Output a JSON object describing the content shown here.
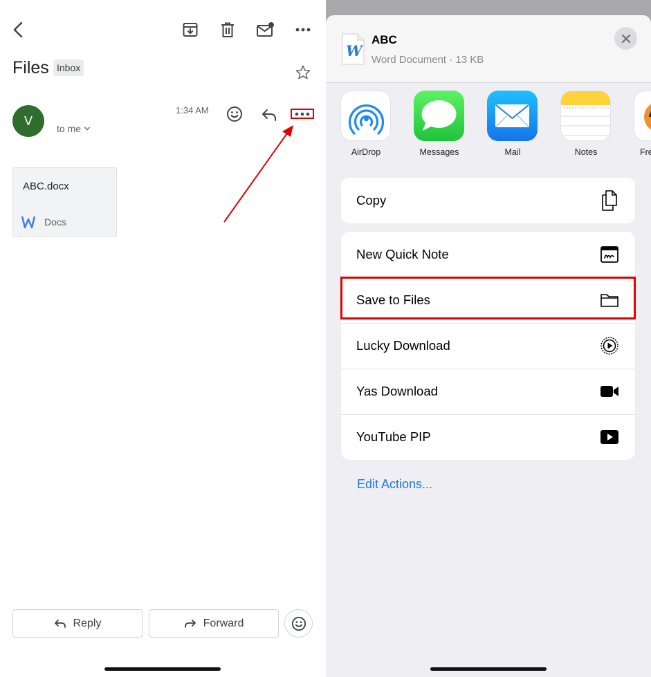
{
  "gmail": {
    "subject": "Files",
    "label_badge": "Inbox",
    "sender_initial": "V",
    "to_me": "to me",
    "time": "1:34 AM",
    "attachment": {
      "name": "ABC.docx",
      "type": "Docs"
    },
    "buttons": {
      "reply": "Reply",
      "forward": "Forward"
    },
    "icons": [
      "back-icon",
      "archive-icon",
      "trash-icon",
      "mark-unread-icon",
      "more-icon",
      "star-icon",
      "emoji-icon",
      "reply-icon",
      "more-horizontal-icon"
    ]
  },
  "share_sheet": {
    "file_name": "ABC",
    "file_meta": "Word Document · 13 KB",
    "apps": [
      {
        "label": "AirDrop"
      },
      {
        "label": "Messages"
      },
      {
        "label": "Mail"
      },
      {
        "label": "Notes"
      },
      {
        "label": "Fre"
      }
    ],
    "copy_action": {
      "label": "Copy"
    },
    "actions": [
      {
        "label": "New Quick Note"
      },
      {
        "label": "Save to Files"
      },
      {
        "label": "Lucky Download"
      },
      {
        "label": "Yas Download"
      },
      {
        "label": "YouTube PIP"
      }
    ],
    "edit_actions": "Edit Actions..."
  },
  "colors": {
    "highlight": "#e00000",
    "avatar": "#2e6d2b",
    "link_blue": "#1a7ae6",
    "word_blue": "#2b7cd3"
  }
}
